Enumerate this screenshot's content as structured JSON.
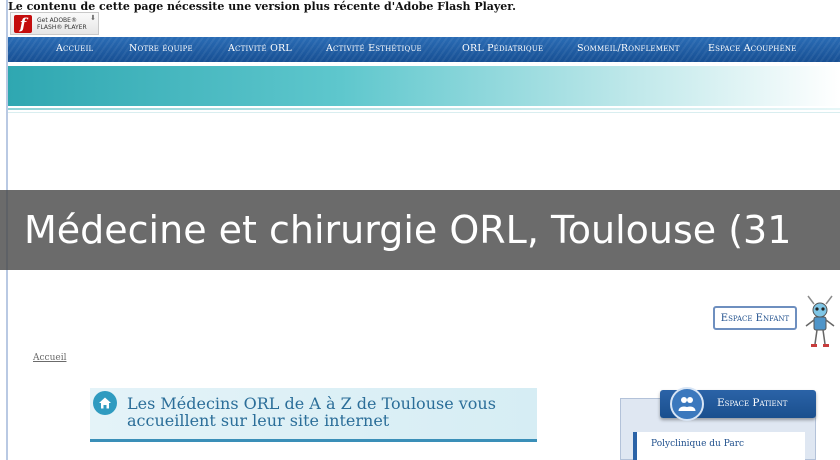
{
  "flash": {
    "notice": "Le contenu de cette page nécessite une version plus récente d'Adobe Flash Player.",
    "badge_line1": "Get ADOBE®",
    "badge_line2": "FLASH® PLAYER"
  },
  "nav": {
    "items": [
      {
        "label": "Accueil"
      },
      {
        "label": "Notre équipe"
      },
      {
        "label": "Activité ORL"
      },
      {
        "label": "Activité Esthétique"
      },
      {
        "label": "ORL Pédiatrique"
      },
      {
        "label": "Sommeil/Ronflement"
      },
      {
        "label": "Espace Acouphène"
      }
    ]
  },
  "overlay": {
    "title": "Médecine et chirurgie ORL, Toulouse (31"
  },
  "espace_enfant": {
    "label": "Espace Enfant"
  },
  "breadcrumb": {
    "label": "Accueil"
  },
  "banner": {
    "line1": "Les Médecins ORL de A à Z de Toulouse vous",
    "line2": "accueillent sur leur site internet"
  },
  "espace_patient": {
    "label": "Espace Patient",
    "link": "Polyclinique du Parc"
  },
  "colors": {
    "nav_blue": "#1f5fa8",
    "teal": "#2fa7b1",
    "banner_text": "#2b6e99",
    "flash_red": "#c40d0d"
  }
}
